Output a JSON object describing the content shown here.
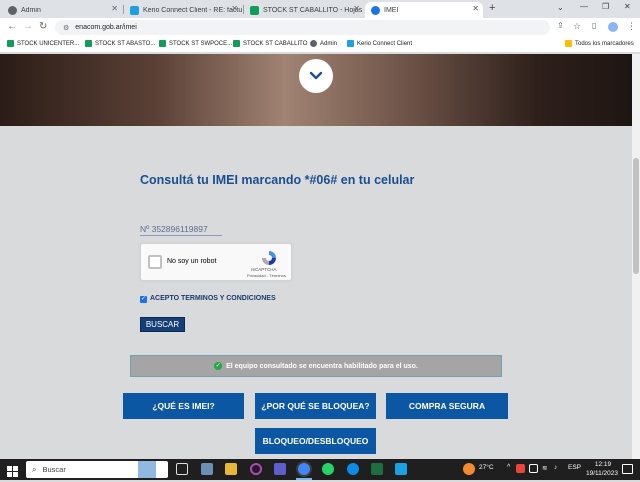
{
  "browser": {
    "tabs": [
      {
        "title": "Admin",
        "icon": "globe-icon",
        "color": "#5f6368"
      },
      {
        "title": "Kerio Connect Client - RE: factu",
        "icon": "kerio-icon",
        "color": "#1ba1e2"
      },
      {
        "title": "STOCK ST CABALLITO - Hojas de",
        "icon": "sheets-icon",
        "color": "#0f9d58"
      },
      {
        "title": "IMEI",
        "icon": "enacom-icon",
        "color": "#1a73e8"
      }
    ],
    "new_tab": "+",
    "url": "enacom.gob.ar/imei",
    "bookmarks": [
      {
        "label": "STOCK UNICENTER...",
        "icon": "sheets-icon"
      },
      {
        "label": "STOCK ST ABASTO...",
        "icon": "sheets-icon"
      },
      {
        "label": "STOCK ST SWPOCE...",
        "icon": "sheets-icon"
      },
      {
        "label": "STOCK ST CABALLITO",
        "icon": "sheets-icon"
      },
      {
        "label": "Admin",
        "icon": "globe-icon"
      },
      {
        "label": "Kerio Connect Client",
        "icon": "kerio-icon"
      }
    ],
    "all_bookmarks": "Todos los marcadores"
  },
  "page": {
    "heading": "Consultá tu IMEI marcando *#06# en tu celular",
    "imei_value": "Nº 352896119897",
    "recaptcha": {
      "label": "No soy un robot",
      "brand": "reCAPTCHA",
      "links": "Privacidad - Términos"
    },
    "terms_label": "ACEPTO TERMINOS Y CONDICIONES",
    "search_button": "BUSCAR",
    "result_message": "El equipo consultado se encuentra habilitado para el uso.",
    "buttons": {
      "what_is_imei": "¿QUÉ ES IMEI?",
      "why_blocked": "¿POR QUÉ SE BLOQUEA?",
      "safe_purchase": "COMPRA SEGURA",
      "block_unblock": "BLOQUEO/DESBLOQUEO"
    },
    "colors": {
      "primary_blue": "#0b57a4",
      "heading_blue": "#1a4f8f",
      "success_green": "#28a745"
    }
  },
  "taskbar": {
    "search_placeholder": "Buscar",
    "temperature": "27°C",
    "language": "ESP",
    "time": "12:19",
    "date": "19/11/2023"
  }
}
